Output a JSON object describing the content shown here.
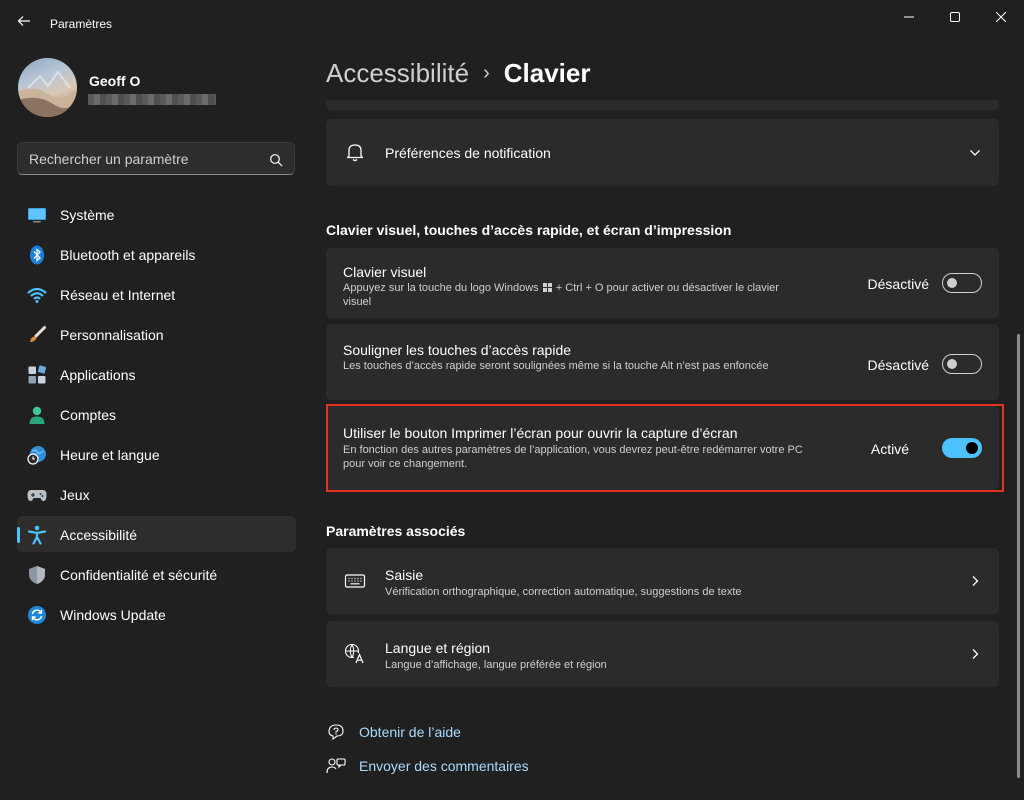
{
  "window": {
    "title": "Paramètres",
    "back_icon": "back-arrow-icon",
    "minimize_icon": "minimize-icon",
    "maximize_icon": "maximize-icon",
    "close_icon": "close-icon"
  },
  "profile": {
    "name": "Geoff O"
  },
  "search": {
    "placeholder": "Rechercher un paramètre",
    "icon": "search-icon"
  },
  "sidebar": {
    "items": [
      {
        "label": "Système",
        "icon": "monitor-icon",
        "active": false
      },
      {
        "label": "Bluetooth et appareils",
        "icon": "bluetooth-icon",
        "active": false
      },
      {
        "label": "Réseau et Internet",
        "icon": "wifi-icon",
        "active": false
      },
      {
        "label": "Personnalisation",
        "icon": "paintbrush-icon",
        "active": false
      },
      {
        "label": "Applications",
        "icon": "apps-icon",
        "active": false
      },
      {
        "label": "Comptes",
        "icon": "person-icon",
        "active": false
      },
      {
        "label": "Heure et langue",
        "icon": "globe-clock-icon",
        "active": false
      },
      {
        "label": "Jeux",
        "icon": "gamepad-icon",
        "active": false
      },
      {
        "label": "Accessibilité",
        "icon": "accessibility-icon",
        "active": true
      },
      {
        "label": "Confidentialité et sécurité",
        "icon": "shield-icon",
        "active": false
      },
      {
        "label": "Windows Update",
        "icon": "update-icon",
        "active": false
      }
    ]
  },
  "breadcrumb": {
    "parent": "Accessibilité",
    "separator": "›",
    "current": "Clavier"
  },
  "notification_card": {
    "title": "Préférences de notification",
    "icon": "bell-icon"
  },
  "section_keyboard": {
    "title": "Clavier visuel, touches d’accès rapide, et écran d’impression"
  },
  "settings": [
    {
      "title": "Clavier visuel",
      "desc_before": "Appuyez sur la touche du logo Windows",
      "desc_after": "+ Ctrl + O pour activer ou désactiver le clavier visuel",
      "state": "Désactivé",
      "on": false
    },
    {
      "title": "Souligner les touches d’accès rapide",
      "desc": "Les touches d’accès rapide seront soulignées même si la touche Alt n’est pas enfoncée",
      "state": "Désactivé",
      "on": false
    },
    {
      "title": "Utiliser le bouton Imprimer l’écran pour ouvrir la capture d’écran",
      "desc": "En fonction des autres paramètres de l’application, vous devrez peut-être redémarrer votre PC pour voir ce changement.",
      "state": "Activé",
      "on": true
    }
  ],
  "section_related": {
    "title": "Paramètres associés"
  },
  "related": [
    {
      "title": "Saisie",
      "desc": "Vérification orthographique, correction automatique, suggestions de texte",
      "icon": "keyboard-icon"
    },
    {
      "title": "Langue et région",
      "desc": "Langue d’affichage, langue préférée et région",
      "icon": "language-icon"
    }
  ],
  "links": [
    {
      "label": "Obtenir de l’aide",
      "icon": "help-icon"
    },
    {
      "label": "Envoyer des commentaires",
      "icon": "feedback-icon"
    }
  ],
  "colors": {
    "accent": "#4cc2ff",
    "highlight_border": "#e2341d",
    "background": "#202020",
    "card": "#2b2b2b"
  }
}
